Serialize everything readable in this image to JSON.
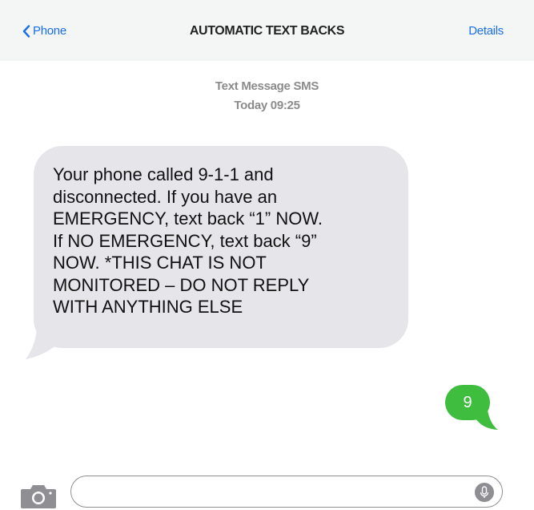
{
  "header": {
    "back_label": "Phone",
    "title": "AUTOMATIC TEXT BACKS",
    "details_label": "Details"
  },
  "meta": {
    "channel": "Text Message  SMS",
    "timestamp": "Today 09:25"
  },
  "messages": [
    {
      "direction": "incoming",
      "text": "Your phone called 9-1-1 and\ndisconnected. If you have an\nEMERGENCY, text back “1” NOW.\nIf NO EMERGENCY, text back “9”\nNOW. *THIS CHAT IS NOT\nMONITORED – DO NOT REPLY\nWITH ANYTHING ELSE"
    },
    {
      "direction": "outgoing",
      "text": "9"
    }
  ],
  "composer": {
    "placeholder": "",
    "camera_icon": "camera-icon",
    "mic_icon": "microphone-icon"
  },
  "colors": {
    "accent": "#1a6fe8",
    "incoming_bubble": "#e5e5ea",
    "outgoing_bubble": "#3fbd3f",
    "header_bg": "#f4f5f5"
  }
}
